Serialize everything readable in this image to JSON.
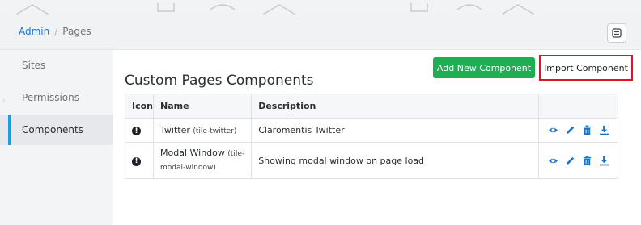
{
  "breadcrumb": {
    "root": "Admin",
    "separator": "/",
    "current": "Pages"
  },
  "header": {
    "menu_icon": "grid-menu-icon"
  },
  "sidebar": {
    "items": [
      {
        "label": "Sites"
      },
      {
        "label": "Permissions"
      },
      {
        "label": "Components",
        "active": true
      }
    ]
  },
  "main": {
    "title": "Custom Pages Components",
    "add_button": "Add New Component",
    "import_button": "Import Component",
    "table": {
      "columns": [
        "Icon",
        "Name",
        "Description",
        ""
      ],
      "rows": [
        {
          "icon": "!",
          "name": "Twitter",
          "slug": "(tile-twitter)",
          "description": "Claromentis Twitter"
        },
        {
          "icon": "!",
          "name": "Modal Window",
          "slug_a": "(tile-",
          "slug_b": "modal-window)",
          "description": "Showing modal window on page load"
        }
      ],
      "action_icons": [
        "eye-icon",
        "pencil-icon",
        "trash-icon",
        "download-icon"
      ]
    }
  },
  "colors": {
    "accent": "#1a9fd9",
    "add_button": "#1fae53",
    "import_highlight": "#e0102a",
    "link": "#1a73c8"
  }
}
